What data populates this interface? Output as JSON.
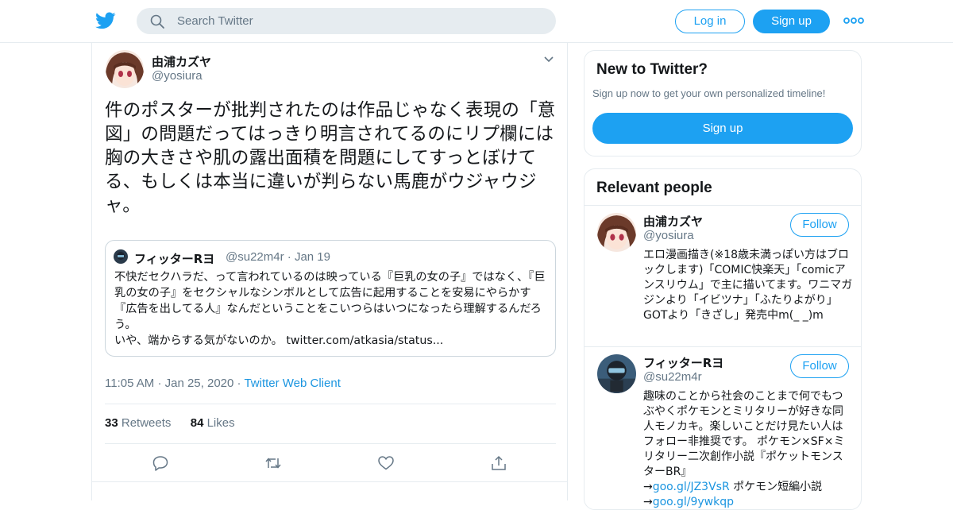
{
  "header": {
    "search_placeholder": "Search Twitter",
    "login_label": "Log in",
    "signup_label": "Sign up",
    "brand_color": "#1da1f2"
  },
  "tweet": {
    "author_name": "由浦カズヤ",
    "author_handle": "@yosiura",
    "text": "件のポスターが批判されたのは作品じゃなく表現の「意図」の問題だってはっきり明言されてるのにリプ欄には胸の大きさや肌の露出面積を問題にしてすっとぼけてる、もしくは本当に違いが判らない馬鹿がウジャウジャ。",
    "quote": {
      "author_name": "フィッターRヨ",
      "author_handle": "@su22m4r",
      "separator": "·",
      "date": "Jan 19",
      "text_line1": "不快だセクハラだ、って言われているのは映っている『巨乳の女の子』ではなく、『巨乳の女の子』をセクシャルなシンボルとして広告に起用することを安易にやらかす『広告を出してる人』なんだということをこいつらはいつになったら理解するんだろう。",
      "text_line2": "いや、端からする気がないのか。",
      "link": "twitter.com/atkasia/status..."
    },
    "time": "11:05 AM",
    "separator": "·",
    "date": "Jan 25, 2020",
    "client": "Twitter Web Client",
    "retweets_count": "33",
    "retweets_label": "Retweets",
    "likes_count": "84",
    "likes_label": "Likes"
  },
  "sidebar": {
    "new_title": "New to Twitter?",
    "new_subtitle": "Sign up now to get your own personalized timeline!",
    "new_signup_label": "Sign up",
    "relevant_title": "Relevant people",
    "people": [
      {
        "name": "由浦カズヤ",
        "handle": "@yosiura",
        "follow_label": "Follow",
        "bio": "エロ漫画描き(※18歳未満っぽい方はブロックします)「COMIC快楽天」「comicアンスリウム」で主に描いてます。ワニマガジンより「イビツナ」「ふたりよがり」GOTより「きざし」発売中m(_ _)m"
      },
      {
        "name": "フィッターRヨ",
        "handle": "@su22m4r",
        "follow_label": "Follow",
        "bio": "趣味のことから社会のことまで何でもつぶやくポケモンとミリタリーが好きな同人モノカキ。楽しいことだけ見たい人はフォロー非推奨です。 ポケモン×SF×ミリタリー二次創作小説『ポケットモンスターBR』",
        "arrow": "→",
        "link1": "goo.gl/JZ3VsR",
        "link1_text": " ポケモン短編小説",
        "link2": "goo.gl/9ywkqp"
      }
    ]
  }
}
